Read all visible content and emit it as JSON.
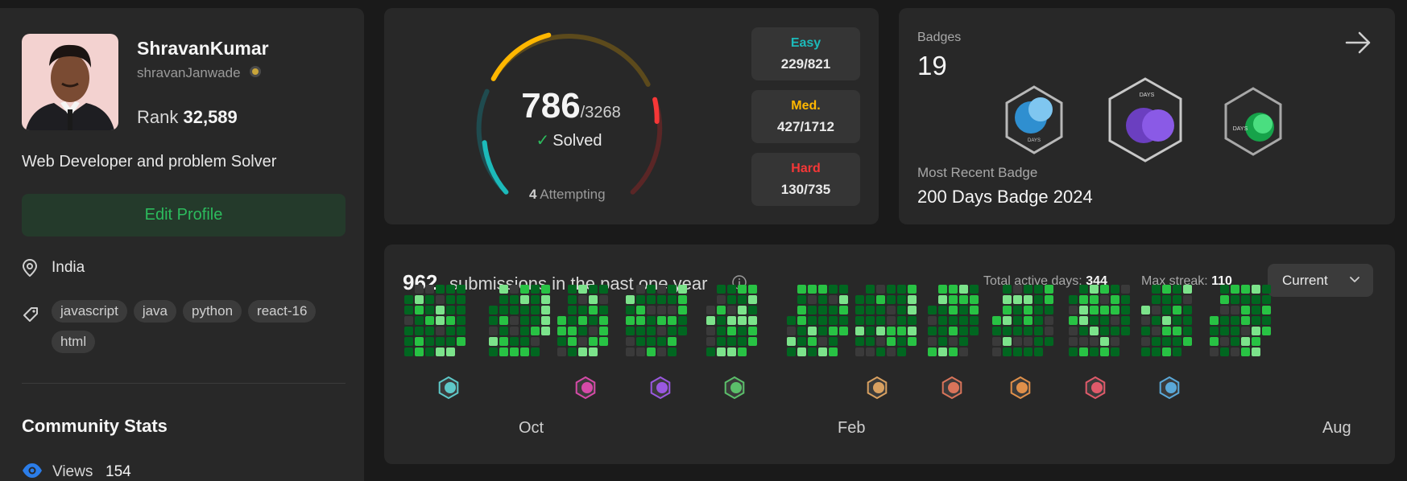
{
  "profile": {
    "name": "ShravanKumar",
    "handle": "shravanJanwade",
    "rank_label": "Rank",
    "rank_value": "32,589",
    "bio": "Web Developer and problem Solver",
    "edit_label": "Edit Profile",
    "location": "India",
    "skills": [
      "javascript",
      "java",
      "python",
      "react-16",
      "html"
    ],
    "community_title": "Community Stats",
    "views_label": "Views",
    "views_value": "154"
  },
  "solved": {
    "count": "786",
    "total": "/3268",
    "label": "Solved",
    "attempting_count": "4",
    "attempting_label": "Attempting",
    "difficulties": [
      {
        "label": "Easy",
        "value": "229/821",
        "color": "#1cbaba",
        "solved": 229,
        "total": 821
      },
      {
        "label": "Med.",
        "value": "427/1712",
        "color": "#ffb700",
        "solved": 427,
        "total": 1712
      },
      {
        "label": "Hard",
        "value": "130/735",
        "color": "#f63737",
        "solved": 130,
        "total": 735
      }
    ]
  },
  "badges": {
    "title": "Badges",
    "count": "19",
    "recent_label": "Most Recent Badge",
    "recent_name": "200 Days Badge 2024",
    "items": [
      {
        "name": "100 days badge",
        "icon": "days-100-badge-icon",
        "text": "DAYS"
      },
      {
        "name": "200 days badge",
        "icon": "days-200-badge-icon",
        "text": "DAYS"
      },
      {
        "name": "50 days badge",
        "icon": "days-50-badge-icon",
        "text": "DAYS"
      }
    ]
  },
  "calendar": {
    "submissions": "962",
    "submissions_text": "submissions in the past one year",
    "active_days_label": "Total active days:",
    "active_days_value": "344",
    "max_streak_label": "Max streak:",
    "max_streak_value": "110",
    "period_selector": "Current",
    "month_labels": [
      "Oct",
      "Feb",
      "Aug"
    ],
    "month_badges": [
      "Sep badge",
      "Nov badge",
      "Dec badge",
      "Jan badge",
      "Mar badge",
      "Apr badge",
      "May badge",
      "Jun badge",
      "Jul badge"
    ],
    "colors": {
      "empty": "#3a3a3a",
      "l1": "#016620",
      "l2": "#28c244",
      "l3": "#7ce38b"
    }
  }
}
